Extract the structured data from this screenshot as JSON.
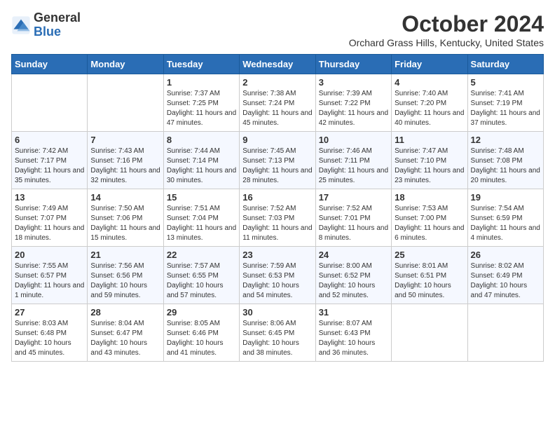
{
  "header": {
    "logo": {
      "general": "General",
      "blue": "Blue"
    },
    "title": "October 2024",
    "subtitle": "Orchard Grass Hills, Kentucky, United States"
  },
  "days_of_week": [
    "Sunday",
    "Monday",
    "Tuesday",
    "Wednesday",
    "Thursday",
    "Friday",
    "Saturday"
  ],
  "weeks": [
    [
      {
        "day": "",
        "info": ""
      },
      {
        "day": "",
        "info": ""
      },
      {
        "day": "1",
        "info": "Sunrise: 7:37 AM\nSunset: 7:25 PM\nDaylight: 11 hours and 47 minutes."
      },
      {
        "day": "2",
        "info": "Sunrise: 7:38 AM\nSunset: 7:24 PM\nDaylight: 11 hours and 45 minutes."
      },
      {
        "day": "3",
        "info": "Sunrise: 7:39 AM\nSunset: 7:22 PM\nDaylight: 11 hours and 42 minutes."
      },
      {
        "day": "4",
        "info": "Sunrise: 7:40 AM\nSunset: 7:20 PM\nDaylight: 11 hours and 40 minutes."
      },
      {
        "day": "5",
        "info": "Sunrise: 7:41 AM\nSunset: 7:19 PM\nDaylight: 11 hours and 37 minutes."
      }
    ],
    [
      {
        "day": "6",
        "info": "Sunrise: 7:42 AM\nSunset: 7:17 PM\nDaylight: 11 hours and 35 minutes."
      },
      {
        "day": "7",
        "info": "Sunrise: 7:43 AM\nSunset: 7:16 PM\nDaylight: 11 hours and 32 minutes."
      },
      {
        "day": "8",
        "info": "Sunrise: 7:44 AM\nSunset: 7:14 PM\nDaylight: 11 hours and 30 minutes."
      },
      {
        "day": "9",
        "info": "Sunrise: 7:45 AM\nSunset: 7:13 PM\nDaylight: 11 hours and 28 minutes."
      },
      {
        "day": "10",
        "info": "Sunrise: 7:46 AM\nSunset: 7:11 PM\nDaylight: 11 hours and 25 minutes."
      },
      {
        "day": "11",
        "info": "Sunrise: 7:47 AM\nSunset: 7:10 PM\nDaylight: 11 hours and 23 minutes."
      },
      {
        "day": "12",
        "info": "Sunrise: 7:48 AM\nSunset: 7:08 PM\nDaylight: 11 hours and 20 minutes."
      }
    ],
    [
      {
        "day": "13",
        "info": "Sunrise: 7:49 AM\nSunset: 7:07 PM\nDaylight: 11 hours and 18 minutes."
      },
      {
        "day": "14",
        "info": "Sunrise: 7:50 AM\nSunset: 7:06 PM\nDaylight: 11 hours and 15 minutes."
      },
      {
        "day": "15",
        "info": "Sunrise: 7:51 AM\nSunset: 7:04 PM\nDaylight: 11 hours and 13 minutes."
      },
      {
        "day": "16",
        "info": "Sunrise: 7:52 AM\nSunset: 7:03 PM\nDaylight: 11 hours and 11 minutes."
      },
      {
        "day": "17",
        "info": "Sunrise: 7:52 AM\nSunset: 7:01 PM\nDaylight: 11 hours and 8 minutes."
      },
      {
        "day": "18",
        "info": "Sunrise: 7:53 AM\nSunset: 7:00 PM\nDaylight: 11 hours and 6 minutes."
      },
      {
        "day": "19",
        "info": "Sunrise: 7:54 AM\nSunset: 6:59 PM\nDaylight: 11 hours and 4 minutes."
      }
    ],
    [
      {
        "day": "20",
        "info": "Sunrise: 7:55 AM\nSunset: 6:57 PM\nDaylight: 11 hours and 1 minute."
      },
      {
        "day": "21",
        "info": "Sunrise: 7:56 AM\nSunset: 6:56 PM\nDaylight: 10 hours and 59 minutes."
      },
      {
        "day": "22",
        "info": "Sunrise: 7:57 AM\nSunset: 6:55 PM\nDaylight: 10 hours and 57 minutes."
      },
      {
        "day": "23",
        "info": "Sunrise: 7:59 AM\nSunset: 6:53 PM\nDaylight: 10 hours and 54 minutes."
      },
      {
        "day": "24",
        "info": "Sunrise: 8:00 AM\nSunset: 6:52 PM\nDaylight: 10 hours and 52 minutes."
      },
      {
        "day": "25",
        "info": "Sunrise: 8:01 AM\nSunset: 6:51 PM\nDaylight: 10 hours and 50 minutes."
      },
      {
        "day": "26",
        "info": "Sunrise: 8:02 AM\nSunset: 6:49 PM\nDaylight: 10 hours and 47 minutes."
      }
    ],
    [
      {
        "day": "27",
        "info": "Sunrise: 8:03 AM\nSunset: 6:48 PM\nDaylight: 10 hours and 45 minutes."
      },
      {
        "day": "28",
        "info": "Sunrise: 8:04 AM\nSunset: 6:47 PM\nDaylight: 10 hours and 43 minutes."
      },
      {
        "day": "29",
        "info": "Sunrise: 8:05 AM\nSunset: 6:46 PM\nDaylight: 10 hours and 41 minutes."
      },
      {
        "day": "30",
        "info": "Sunrise: 8:06 AM\nSunset: 6:45 PM\nDaylight: 10 hours and 38 minutes."
      },
      {
        "day": "31",
        "info": "Sunrise: 8:07 AM\nSunset: 6:43 PM\nDaylight: 10 hours and 36 minutes."
      },
      {
        "day": "",
        "info": ""
      },
      {
        "day": "",
        "info": ""
      }
    ]
  ]
}
